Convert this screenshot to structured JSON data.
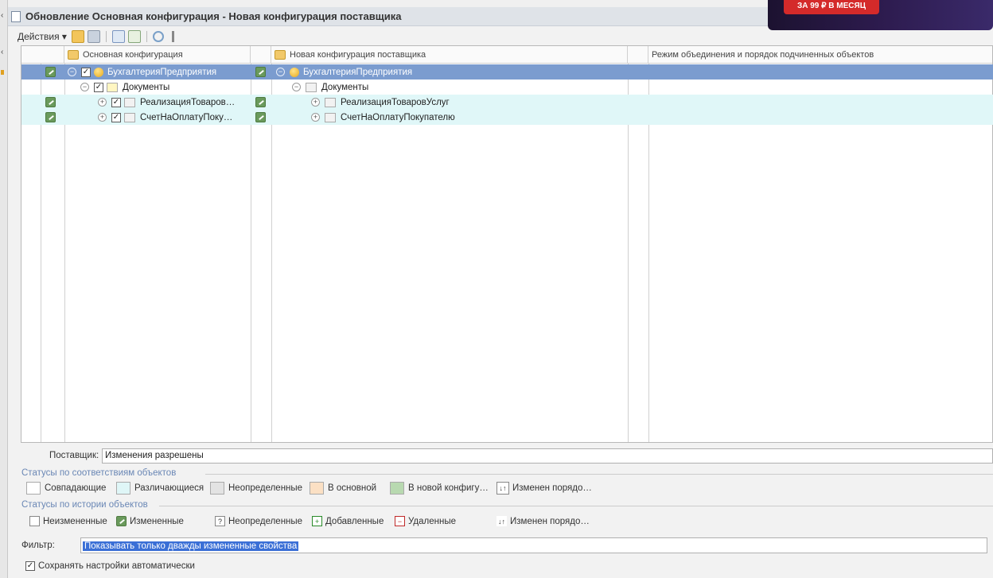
{
  "window": {
    "title": "Обновление Основная конфигурация - Новая конфигурация поставщика"
  },
  "banner": {
    "text": "ЗА 99 ₽ В МЕСЯЦ"
  },
  "toolbar": {
    "actions_label": "Действия ▾"
  },
  "columns": {
    "main": "Основная конфигурация",
    "vendor": "Новая конфигурация поставщика",
    "mode": "Режим объединения и порядок подчиненных объектов"
  },
  "tree": {
    "root": {
      "main_label": "БухгалтерияПредприятия",
      "vendor_label": "БухгалтерияПредприятия"
    },
    "docs": {
      "main_label": "Документы",
      "vendor_label": "Документы"
    },
    "items": [
      {
        "main_label": "РеализацияТоваров…",
        "vendor_label": "РеализацияТоваровУслуг"
      },
      {
        "main_label": "СчетНаОплатуПоку…",
        "vendor_label": "СчетНаОплатуПокупателю"
      }
    ]
  },
  "supplier": {
    "label": "Поставщик:",
    "value": "Изменения разрешены"
  },
  "status_match": {
    "title": "Статусы по соответствиям объектов",
    "items": {
      "same": "Совпадающие",
      "diff": "Различающиеся",
      "undef": "Неопределенные",
      "main": "В основной",
      "new": "В новой конфигу…",
      "order": "Изменен порядо…"
    },
    "colors": {
      "same": "#ffffff",
      "diff": "#dff6f7",
      "undef": "#e3e3e3",
      "main": "#fbe0c4",
      "new": "#b8d9b0"
    }
  },
  "status_history": {
    "title": "Статусы по истории объектов",
    "items": {
      "unchanged": "Неизмененные",
      "changed": "Измененные",
      "undef": "Неопределенные",
      "added": "Добавленные",
      "deleted": "Удаленные",
      "order": "Изменен порядо…"
    }
  },
  "filter": {
    "label": "Фильтр:",
    "value": "Показывать только дважды измененные свойства"
  },
  "autosave": {
    "label": "Сохранять настройки автоматически"
  },
  "icons": [
    "pen-icon",
    "checkbox-icon",
    "expand-icon",
    "folder-icon",
    "config-ball-icon"
  ]
}
